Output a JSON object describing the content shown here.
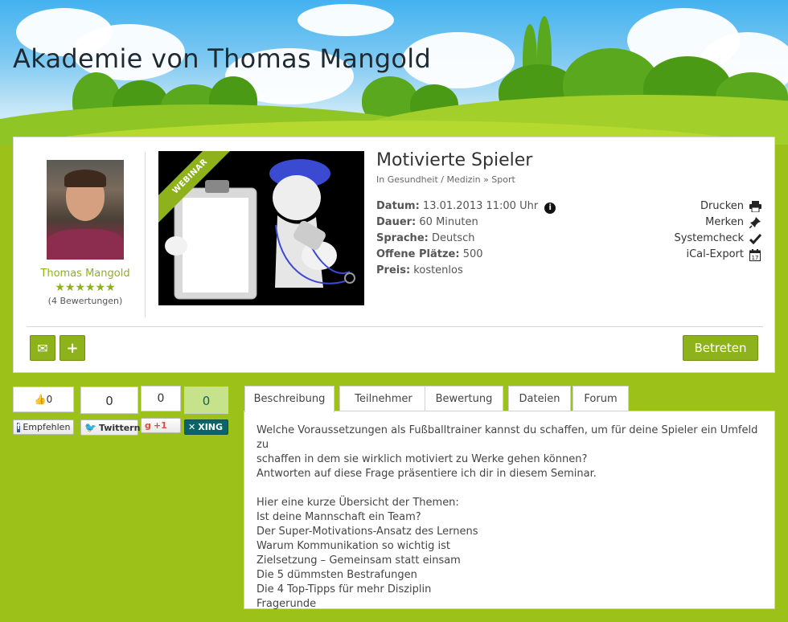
{
  "site": {
    "title": "Akademie von Thomas Mangold"
  },
  "author": {
    "name": "Thomas Mangold",
    "stars": "★★★★★★",
    "ratings": "(4 Bewertungen)"
  },
  "event": {
    "ribbon": "WEBINAR",
    "title": "Motivierte Spieler",
    "breadcrumb": "In Gesundheit / Medizin » Sport",
    "details": [
      {
        "label": "Datum:",
        "value": "13.01.2013 11:00 Uhr"
      },
      {
        "label": "Dauer:",
        "value": "60 Minuten"
      },
      {
        "label": "Sprache:",
        "value": "Deutsch"
      },
      {
        "label": "Offene Plätze:",
        "value": "500"
      },
      {
        "label": "Preis:",
        "value": "kostenlos"
      }
    ],
    "info_icon": "i"
  },
  "actions": [
    {
      "label": "Drucken",
      "icon": "printer-icon"
    },
    {
      "label": "Merken",
      "icon": "pin-icon"
    },
    {
      "label": "Systemcheck",
      "icon": "check-icon"
    },
    {
      "label": "iCal-Export",
      "icon": "calendar-icon"
    }
  ],
  "buttons": {
    "mail": "✉",
    "add": "+",
    "enter": "Betreten"
  },
  "social": {
    "facebook": {
      "count": "0",
      "label": "Empfehlen"
    },
    "twitter": {
      "count": "0",
      "label": "Twittern"
    },
    "gplus": {
      "count": "0",
      "label": "+1"
    },
    "xing": {
      "count": "0",
      "label": "XING"
    }
  },
  "tabs": [
    "Beschreibung",
    "Teilnehmer",
    "Bewertung",
    "Dateien",
    "Forum"
  ],
  "description": {
    "intro": [
      "Welche Voraussetzungen als Fußballtrainer kannst du schaffen, um für deine Spieler ein Umfeld zu",
      "schaffen in dem sie wirklich motiviert zu Werke gehen können?",
      "Antworten auf diese Frage präsentiere ich dir in diesem Seminar."
    ],
    "topics": [
      "Hier eine kurze Übersicht der Themen:",
      "Ist deine Mannschaft ein Team?",
      "Der Super-Motivations-Ansatz des Lernens",
      "Warum Kommunikation so wichtig ist",
      "Zielsetzung – Gemeinsam statt einsam",
      "Die 5 dümmsten Bestrafungen",
      "Die 4 Top-Tipps für mehr Disziplin",
      "Fragerunde"
    ]
  },
  "colors": {
    "accent": "#8db21b",
    "page_bg": "#9cc21a",
    "xing": "#0b6468"
  }
}
